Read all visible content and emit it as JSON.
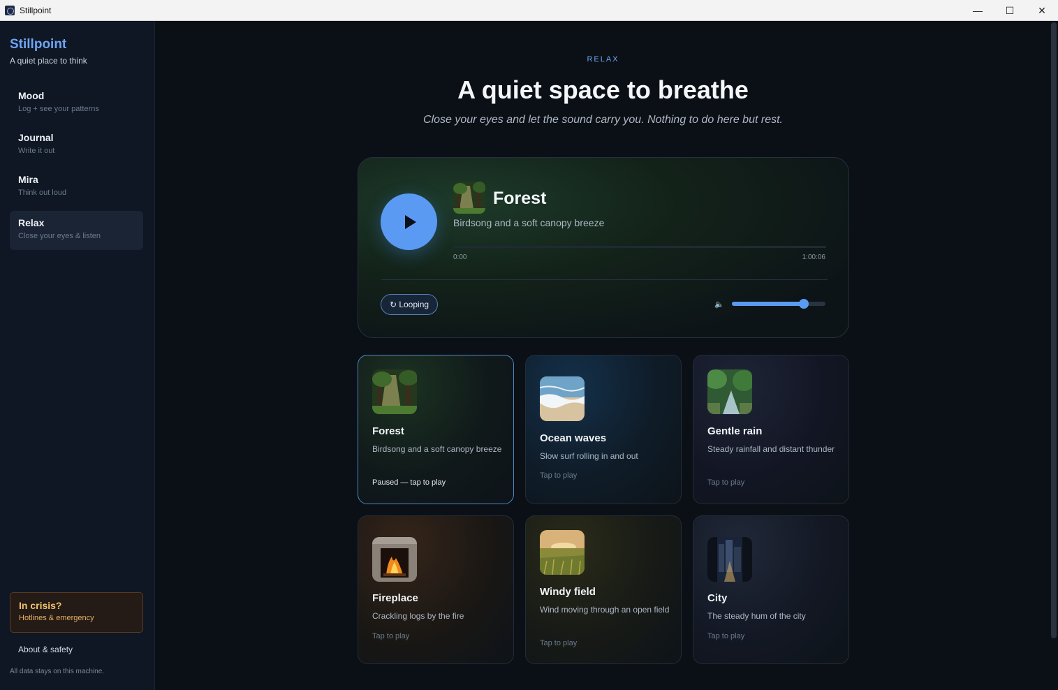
{
  "window": {
    "title": "Stillpoint",
    "minimize": "—",
    "maximize": "☐",
    "close": "✕"
  },
  "sidebar": {
    "brand": "Stillpoint",
    "tagline": "A quiet place to think",
    "items": [
      {
        "label": "Mood",
        "sub": "Log + see your patterns"
      },
      {
        "label": "Journal",
        "sub": "Write it out"
      },
      {
        "label": "Mira",
        "sub": "Think out loud"
      },
      {
        "label": "Relax",
        "sub": "Close your eyes & listen"
      }
    ],
    "crisis": {
      "title": "In crisis?",
      "sub": "Hotlines & emergency"
    },
    "about": "About & safety",
    "footnote": "All data stays on this machine."
  },
  "main": {
    "eyebrow": "RELAX",
    "headline": "A quiet space to breathe",
    "subhead": "Close your eyes and let the sound carry you. Nothing to do here but rest."
  },
  "player": {
    "title": "Forest",
    "subtitle": "Birdsong and a soft canopy breeze",
    "time_current": "0:00",
    "time_total": "1:00:06",
    "progress": 0,
    "loop_label": "↻ Looping",
    "volume_icon": "🔈",
    "volume": 0.77
  },
  "sounds": [
    {
      "title": "Forest",
      "sub": "Birdsong and a soft canopy breeze",
      "status": "Paused — tap to play",
      "icon": "forest-thumbnail-icon"
    },
    {
      "title": "Ocean waves",
      "sub": "Slow surf rolling in and out",
      "status": "Tap to play",
      "icon": "ocean-thumbnail-icon"
    },
    {
      "title": "Gentle rain",
      "sub": "Steady rainfall and distant thunder",
      "status": "Tap to play",
      "icon": "rain-thumbnail-icon"
    },
    {
      "title": "Fireplace",
      "sub": "Crackling logs by the fire",
      "status": "Tap to play",
      "icon": "fireplace-thumbnail-icon"
    },
    {
      "title": "Windy field",
      "sub": "Wind moving through an open field",
      "status": "Tap to play",
      "icon": "field-thumbnail-icon"
    },
    {
      "title": "City",
      "sub": "The steady hum of the city",
      "status": "Tap to play",
      "icon": "city-thumbnail-icon"
    }
  ],
  "colors": {
    "accent": "#5b9af3",
    "brand": "#6ea5f5",
    "crisis": "#f2c46a"
  }
}
